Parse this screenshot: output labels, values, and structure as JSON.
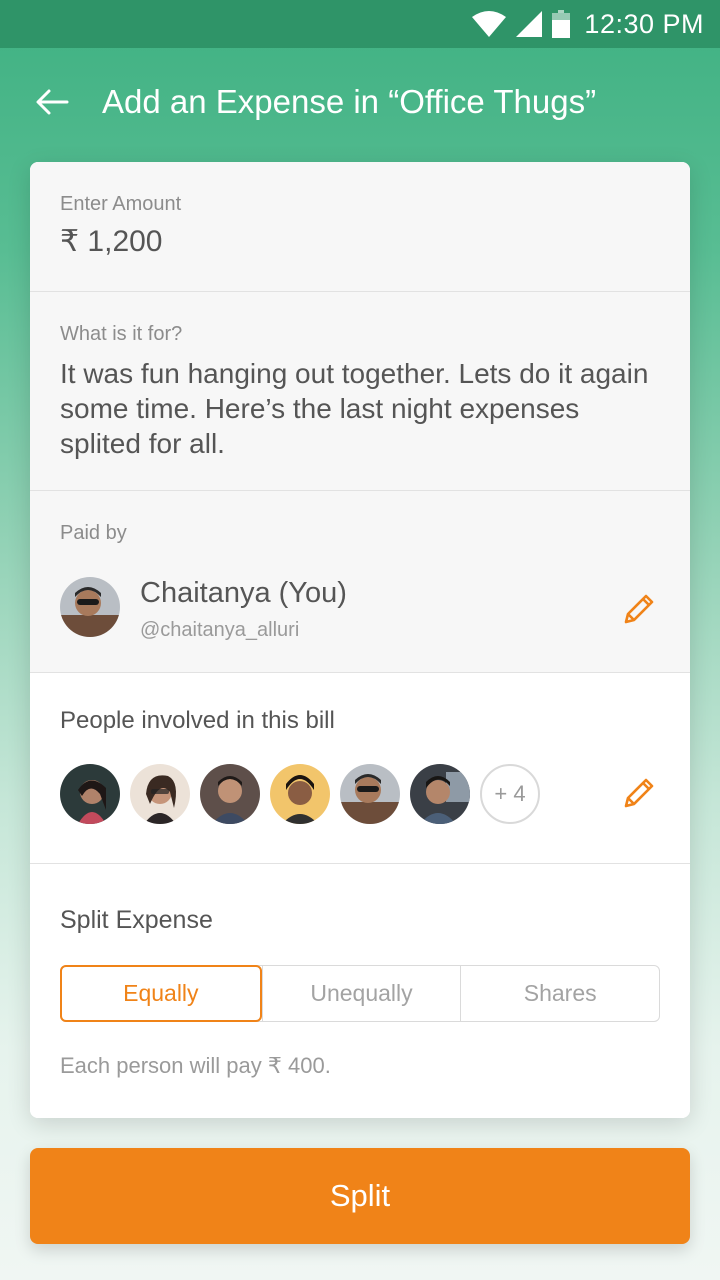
{
  "status_bar": {
    "time": "12:30 PM"
  },
  "app_bar": {
    "title": "Add an Expense in “Office Thugs”"
  },
  "amount": {
    "label": "Enter Amount",
    "value": "₹ 1,200"
  },
  "description": {
    "label": "What is it for?",
    "value": "It was fun hanging out together. Lets do it again some time. Here’s the last night expenses splited for all."
  },
  "paid_by": {
    "label": "Paid by",
    "name": "Chaitanya (You)",
    "handle": "@chaitanya_alluri"
  },
  "people": {
    "title": "People involved in this bill",
    "more_count": "+ 4"
  },
  "split": {
    "title": "Split Expense",
    "options": [
      "Equally",
      "Unequally",
      "Shares"
    ],
    "selected": "Equally",
    "note": "Each person will pay ₹ 400."
  },
  "actions": {
    "split_label": "Split"
  },
  "colors": {
    "accent": "#f08318",
    "header_green": "#2f9468",
    "bg_green": "#3fb182"
  },
  "icons": {
    "back": "arrow-left-icon",
    "edit": "pencil-icon",
    "wifi": "wifi-icon",
    "signal": "signal-icon",
    "battery": "battery-icon"
  }
}
